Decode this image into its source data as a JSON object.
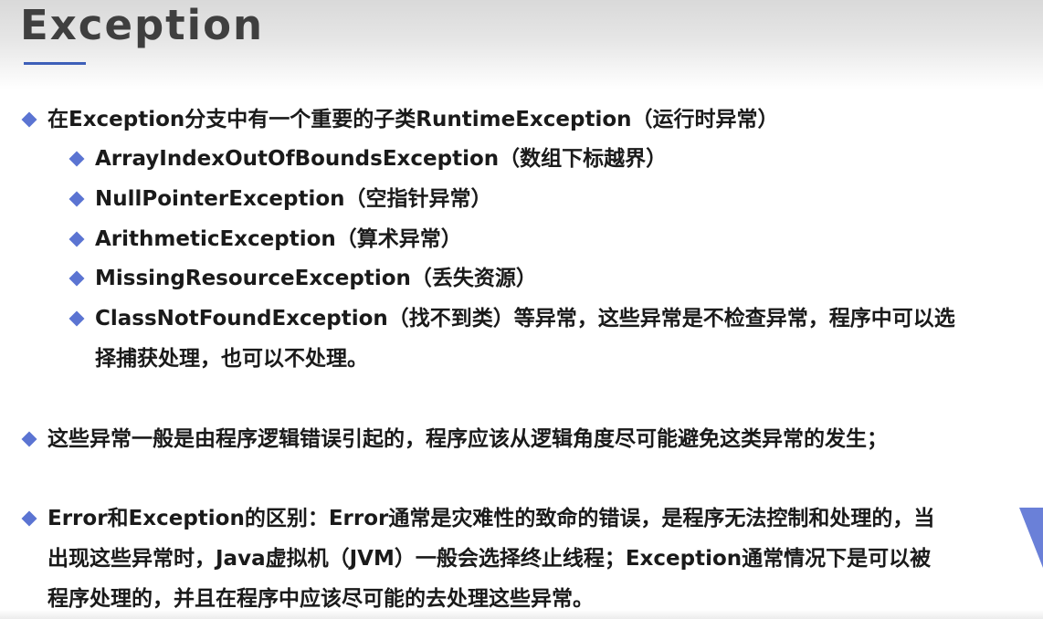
{
  "title": "Exception",
  "colors": {
    "accent": "#5b74d2",
    "title_text": "#3f3f3f",
    "underline": "#3d5fb8",
    "body_text": "#1a1a1a"
  },
  "bullets": {
    "b1": "在Exception分支中有一个重要的子类RuntimeException（运行时异常）",
    "sub": [
      "ArrayIndexOutOfBoundsException（数组下标越界）",
      "NullPointerException（空指针异常）",
      "ArithmeticException（算术异常）",
      "MissingResourceException（丢失资源）",
      "ClassNotFoundException（找不到类）等异常，这些异常是不检查异常，程序中可以选",
      "择捕获处理，也可以不处理。"
    ],
    "b2": "这些异常一般是由程序逻辑错误引起的，程序应该从逻辑角度尽可能避免这类异常的发生；",
    "b3_lines": [
      "Error和Exception的区别：Error通常是灾难性的致命的错误，是程序无法控制和处理的，当",
      "出现这些异常时，Java虚拟机（JVM）一般会选择终止线程；Exception通常情况下是可以被",
      "程序处理的，并且在程序中应该尽可能的去处理这些异常。"
    ]
  },
  "icons": {
    "bullet": "diamond-bullet-icon"
  }
}
